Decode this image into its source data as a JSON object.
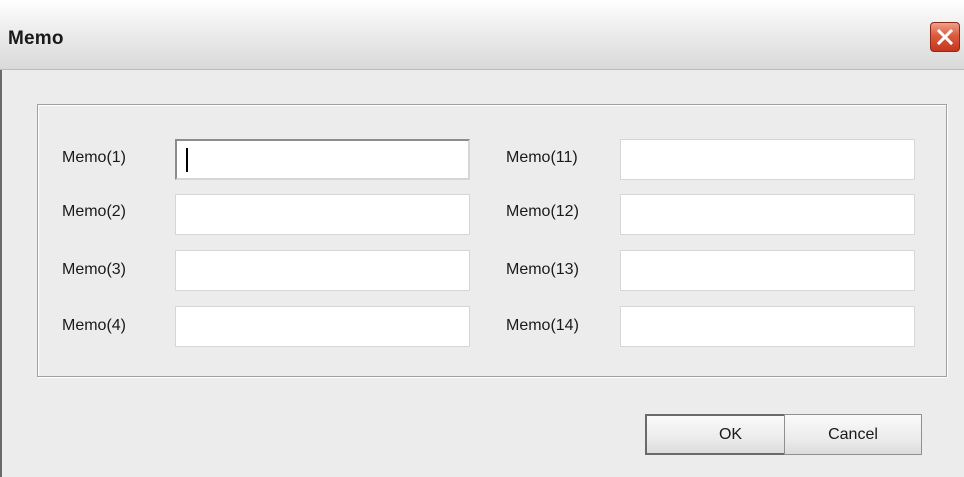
{
  "window": {
    "title": "Memo"
  },
  "icons": {
    "close": "close-icon"
  },
  "colors": {
    "close_button": "#dc5a3e",
    "background": "#ececec"
  },
  "memos_left": [
    {
      "label": "Memo(1)",
      "value": ""
    },
    {
      "label": "Memo(2)",
      "value": ""
    },
    {
      "label": "Memo(3)",
      "value": ""
    },
    {
      "label": "Memo(4)",
      "value": ""
    }
  ],
  "memos_right": [
    {
      "label": "Memo(11)",
      "value": ""
    },
    {
      "label": "Memo(12)",
      "value": ""
    },
    {
      "label": "Memo(13)",
      "value": ""
    },
    {
      "label": "Memo(14)",
      "value": ""
    }
  ],
  "buttons": {
    "ok_label": "OK",
    "cancel_label": "Cancel"
  }
}
